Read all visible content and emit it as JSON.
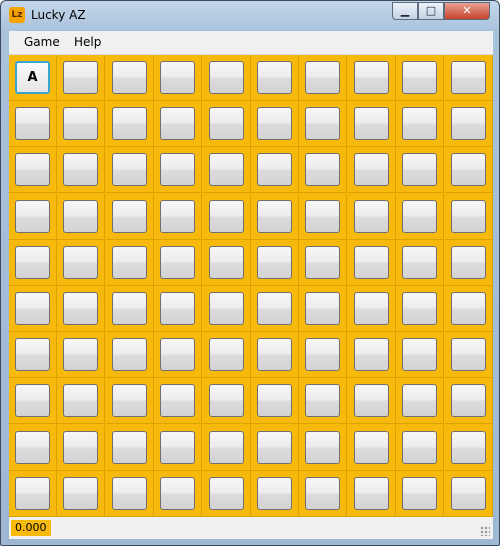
{
  "window": {
    "title": "Lucky AZ"
  },
  "icons": {
    "app": "lucky-az-app-icon",
    "minimize": "minimize-icon",
    "maximize": "maximize-icon",
    "close": "close-icon"
  },
  "window_buttons": {
    "minimize": "▁",
    "maximize": "□",
    "close": "✕"
  },
  "menu": {
    "items": [
      "Game",
      "Help"
    ]
  },
  "board": {
    "rows": 10,
    "cols": 10,
    "revealed": [
      {
        "row": 0,
        "col": 0,
        "label": "A"
      }
    ]
  },
  "status": {
    "time": "0.000"
  },
  "colors": {
    "board": "#f7b90b",
    "accent": "#3aa6d0"
  }
}
